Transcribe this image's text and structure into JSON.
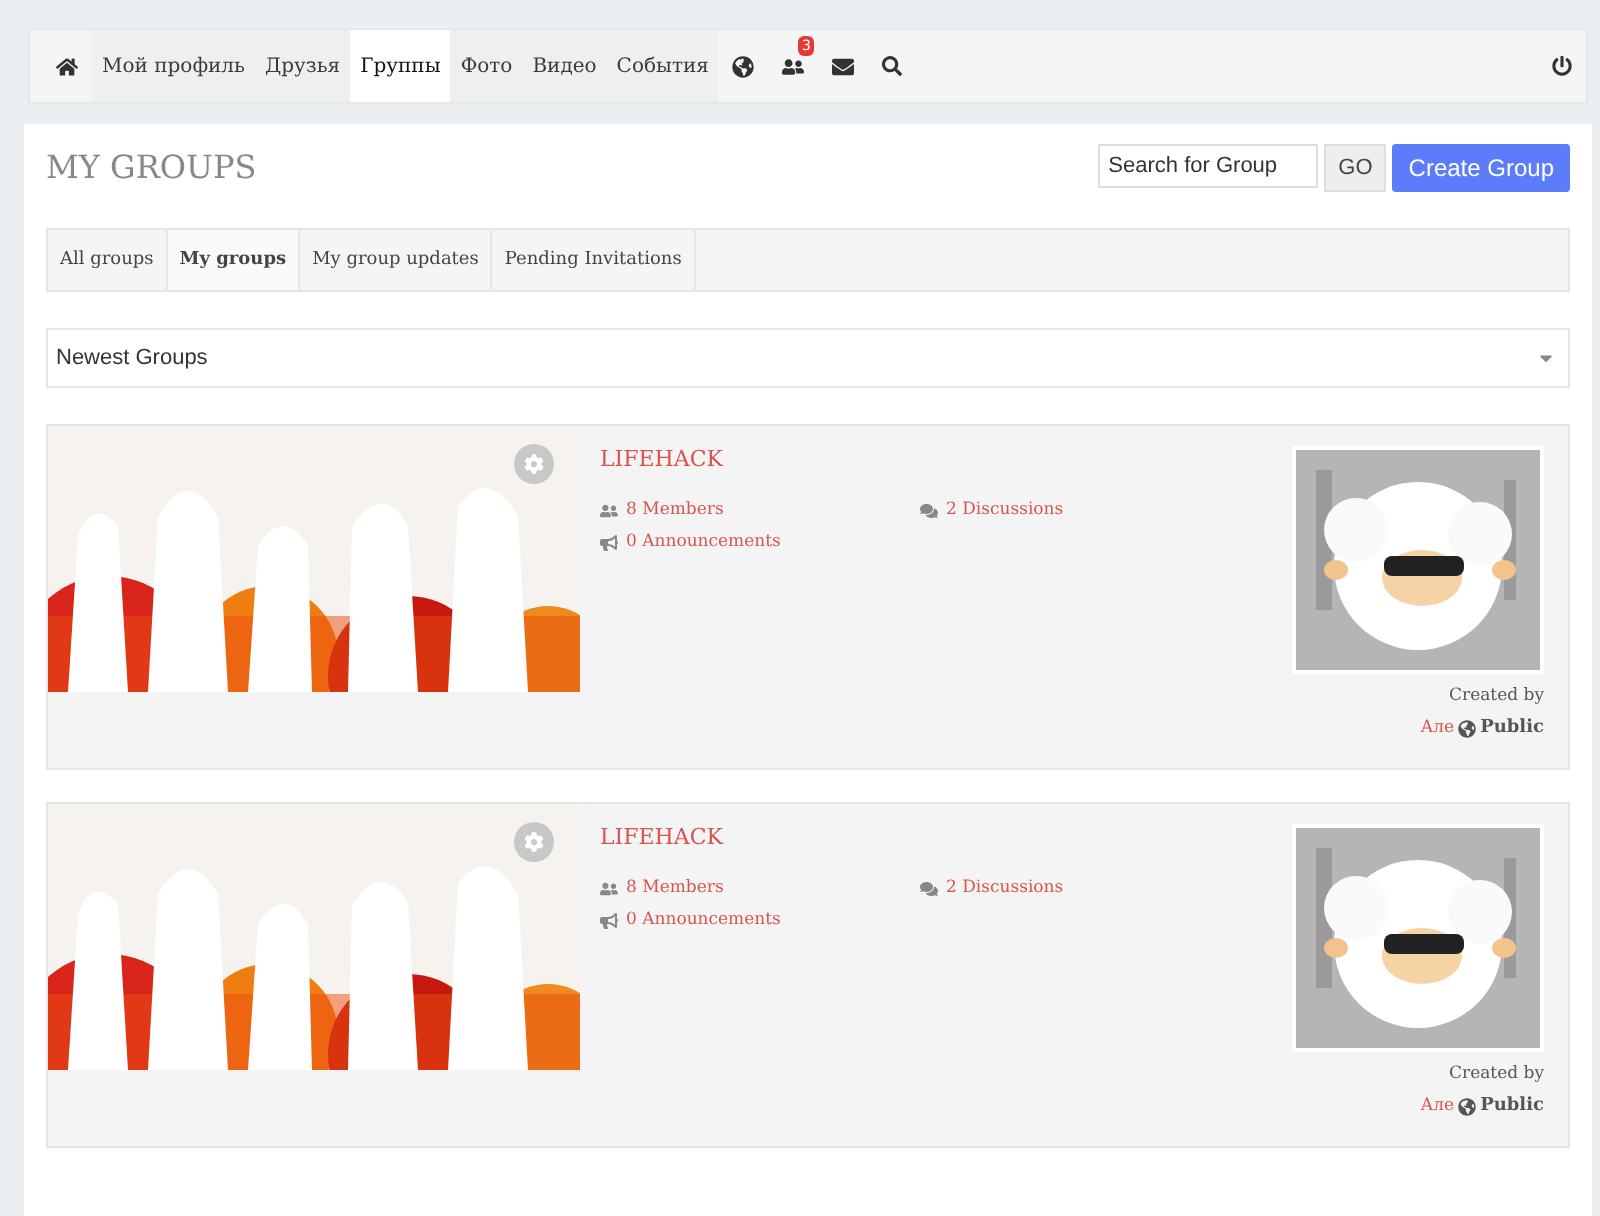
{
  "nav": {
    "items": [
      {
        "label": "Мой профиль",
        "selected": false
      },
      {
        "label": "Друзья",
        "selected": false
      },
      {
        "label": "Группы",
        "selected": true
      },
      {
        "label": "Фото",
        "selected": false
      },
      {
        "label": "Видео",
        "selected": false
      },
      {
        "label": "События",
        "selected": false
      }
    ],
    "notification_badge": "3"
  },
  "page_title": "MY GROUPS",
  "search": {
    "placeholder": "Search for Group"
  },
  "go_button": "GO",
  "create_button": "Create Group",
  "tabs": [
    {
      "label": "All groups",
      "selected": false
    },
    {
      "label": "My groups",
      "selected": true
    },
    {
      "label": "My group updates",
      "selected": false
    },
    {
      "label": "Pending Invitations",
      "selected": false
    }
  ],
  "sort_select": {
    "value": "Newest Groups"
  },
  "groups": [
    {
      "title": "LIFEHACK",
      "members": "8 Members",
      "discussions": "2 Discussions",
      "announcements": "0 Announcements",
      "created_by": "Created by",
      "creator": "Але",
      "privacy": "Public"
    },
    {
      "title": "LIFEHACK",
      "members": "8 Members",
      "discussions": "2 Discussions",
      "announcements": "0 Announcements",
      "created_by": "Created by",
      "creator": "Але",
      "privacy": "Public"
    }
  ]
}
